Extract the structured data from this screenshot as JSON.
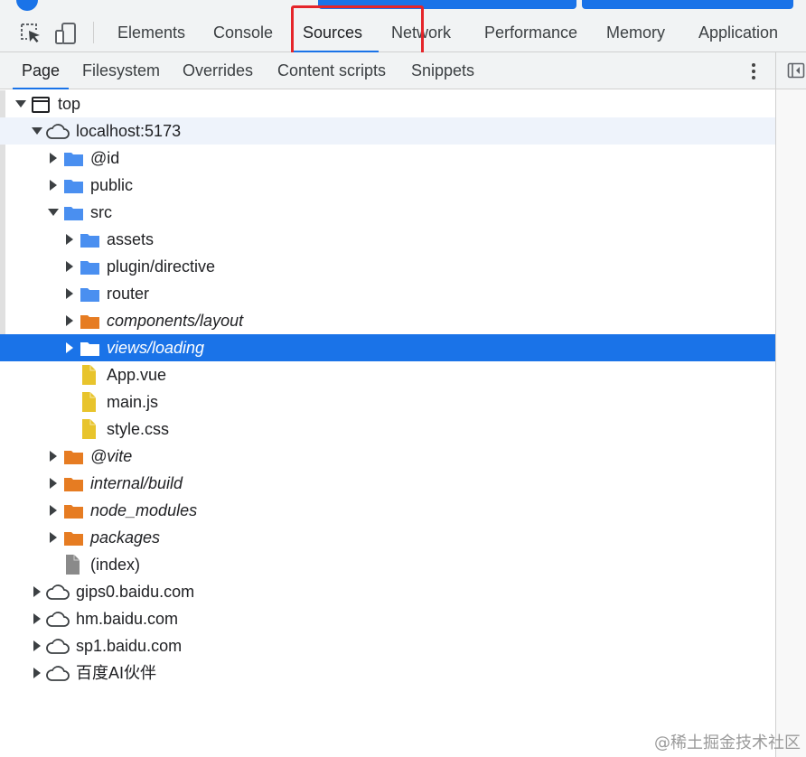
{
  "main_tabs": [
    {
      "label": "Elements"
    },
    {
      "label": "Console"
    },
    {
      "label": "Sources",
      "active": true
    },
    {
      "label": "Network"
    },
    {
      "label": "Performance"
    },
    {
      "label": "Memory"
    },
    {
      "label": "Application"
    }
  ],
  "sub_tabs": [
    {
      "label": "Page",
      "active": true
    },
    {
      "label": "Filesystem"
    },
    {
      "label": "Overrides"
    },
    {
      "label": "Content scripts"
    },
    {
      "label": "Snippets"
    }
  ],
  "tree": [
    {
      "label": "top",
      "depth": 0,
      "expander": "expanded",
      "icon": "frame-icon"
    },
    {
      "label": "localhost:5173",
      "depth": 1,
      "expander": "expanded",
      "icon": "cloud-icon",
      "hover": true
    },
    {
      "label": "@id",
      "depth": 2,
      "expander": "collapsed",
      "icon": "folder-icon"
    },
    {
      "label": "public",
      "depth": 2,
      "expander": "collapsed",
      "icon": "folder-icon"
    },
    {
      "label": "src",
      "depth": 2,
      "expander": "expanded",
      "icon": "folder-icon"
    },
    {
      "label": "assets",
      "depth": 3,
      "expander": "collapsed",
      "icon": "folder-icon"
    },
    {
      "label": "plugin/directive",
      "depth": 3,
      "expander": "collapsed",
      "icon": "folder-icon"
    },
    {
      "label": "router",
      "depth": 3,
      "expander": "collapsed",
      "icon": "folder-icon"
    },
    {
      "label": "components/layout",
      "depth": 3,
      "expander": "collapsed",
      "icon": "folder-icon-orange",
      "italic": true
    },
    {
      "label": "views/loading",
      "depth": 3,
      "expander": "collapsed",
      "icon": "folder-icon",
      "italic": true,
      "selected": true
    },
    {
      "label": "App.vue",
      "depth": 3,
      "expander": "none",
      "icon": "file-icon-yellow"
    },
    {
      "label": "main.js",
      "depth": 3,
      "expander": "none",
      "icon": "file-icon-yellow"
    },
    {
      "label": "style.css",
      "depth": 3,
      "expander": "none",
      "icon": "file-icon-yellow"
    },
    {
      "label": "@vite",
      "depth": 2,
      "expander": "collapsed",
      "icon": "folder-icon-orange",
      "italic": true
    },
    {
      "label": "internal/build",
      "depth": 2,
      "expander": "collapsed",
      "icon": "folder-icon-orange",
      "italic": true
    },
    {
      "label": "node_modules",
      "depth": 2,
      "expander": "collapsed",
      "icon": "folder-icon-orange",
      "italic": true
    },
    {
      "label": "packages",
      "depth": 2,
      "expander": "collapsed",
      "icon": "folder-icon-orange",
      "italic": true
    },
    {
      "label": "(index)",
      "depth": 2,
      "expander": "none",
      "icon": "file-icon-gray"
    },
    {
      "label": "gips0.baidu.com",
      "depth": 1,
      "expander": "collapsed",
      "icon": "cloud-icon"
    },
    {
      "label": "hm.baidu.com",
      "depth": 1,
      "expander": "collapsed",
      "icon": "cloud-icon"
    },
    {
      "label": "sp1.baidu.com",
      "depth": 1,
      "expander": "collapsed",
      "icon": "cloud-icon"
    },
    {
      "label": "百度AI伙伴",
      "depth": 1,
      "expander": "collapsed",
      "icon": "cloud-icon"
    }
  ],
  "watermark": "@稀土掘金技术社区",
  "colors": {
    "accent": "#1a73e8",
    "highlight_box": "#e5252a",
    "folder_blue": "#4a8ff0",
    "folder_orange": "#e67c22",
    "file_yellow": "#e8c42c",
    "file_gray": "#8a8a8a"
  }
}
